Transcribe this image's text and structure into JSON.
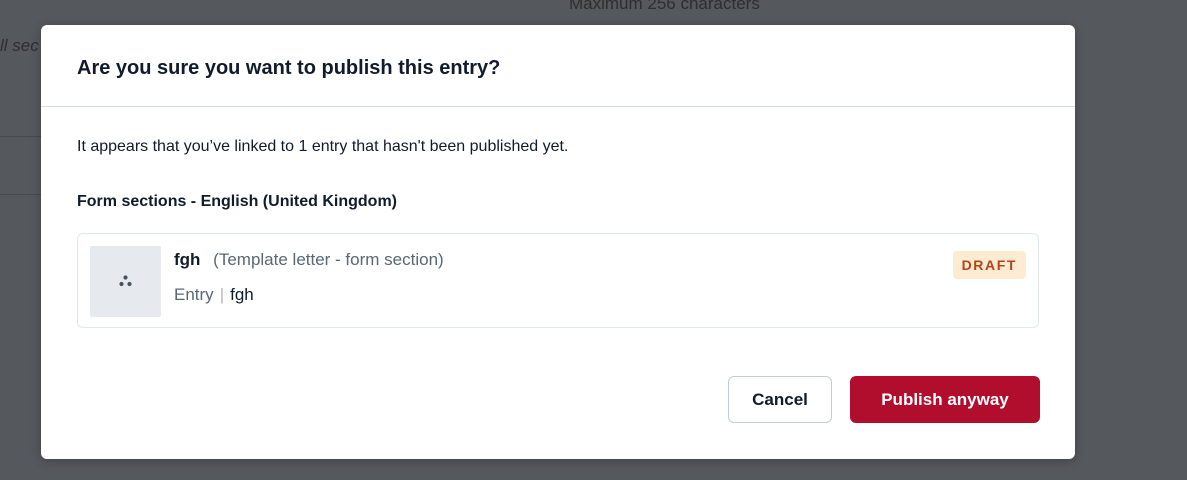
{
  "background": {
    "hint_top": "Maximum 256 characters",
    "hint_left": "ll sec"
  },
  "modal": {
    "title": "Are you sure you want to publish this entry?",
    "message": "It appears that you’ve linked to 1 entry that hasn't been published yet.",
    "section_heading": "Form sections - English (United Kingdom)",
    "entry": {
      "title": "fgh",
      "content_type": "(Template letter - form section)",
      "kind": "Entry",
      "separator": "|",
      "name": "fgh",
      "status": "DRAFT",
      "thumbnail_icon": "entry-placeholder-icon"
    },
    "buttons": {
      "cancel": "Cancel",
      "publish": "Publish anyway"
    }
  },
  "colors": {
    "overlay": "#55585d",
    "primary_danger": "#b10d2d",
    "draft_badge_bg": "#fdebd2",
    "draft_badge_text": "#b8431a"
  }
}
